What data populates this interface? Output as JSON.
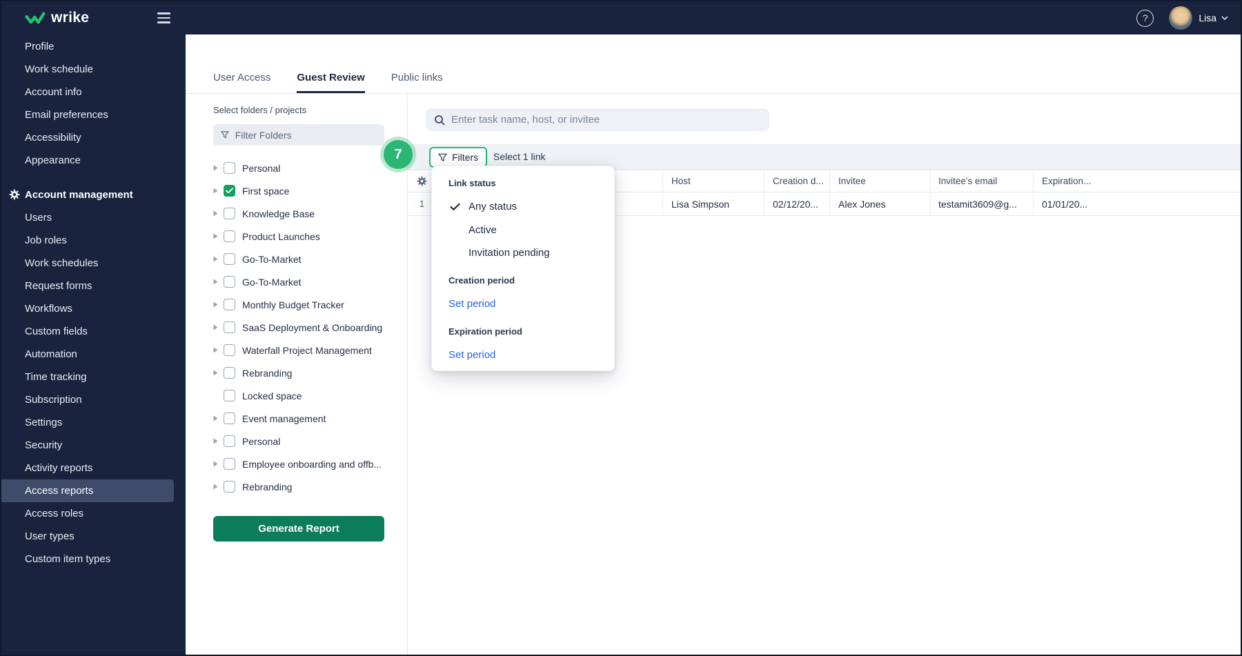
{
  "colors": {
    "navy": "#19233E",
    "brand_green": "#23C16E",
    "annotation_green": "#2BB673",
    "button_green": "#0B7D5A",
    "checkbox_green": "#12A05F",
    "link_blue": "#2563EB"
  },
  "topbar": {
    "logo_text": "wrike",
    "help_label": "?",
    "user_name": "Lisa"
  },
  "sidebar": {
    "items_top": [
      {
        "label": "Profile"
      },
      {
        "label": "Work schedule"
      },
      {
        "label": "Account info"
      },
      {
        "label": "Email preferences"
      },
      {
        "label": "Accessibility"
      },
      {
        "label": "Appearance"
      }
    ],
    "section_header": "Account management",
    "items": [
      {
        "label": "Users"
      },
      {
        "label": "Job roles"
      },
      {
        "label": "Work schedules"
      },
      {
        "label": "Request forms"
      },
      {
        "label": "Workflows"
      },
      {
        "label": "Custom fields"
      },
      {
        "label": "Automation"
      },
      {
        "label": "Time tracking"
      },
      {
        "label": "Subscription"
      },
      {
        "label": "Settings"
      },
      {
        "label": "Security"
      },
      {
        "label": "Activity reports"
      },
      {
        "label": "Access reports"
      },
      {
        "label": "Access roles"
      },
      {
        "label": "User types"
      },
      {
        "label": "Custom item types"
      }
    ],
    "selected_item": "Access reports"
  },
  "tabs": [
    {
      "label": "User Access",
      "active": false
    },
    {
      "label": "Guest Review",
      "active": true
    },
    {
      "label": "Public links",
      "active": false
    }
  ],
  "folder_panel": {
    "title": "Select folders / projects",
    "filter_placeholder": "Filter Folders",
    "tree": [
      {
        "label": "Personal",
        "checked": false,
        "expandable": true
      },
      {
        "label": "First space",
        "checked": true,
        "expandable": true
      },
      {
        "label": "Knowledge Base",
        "checked": false,
        "expandable": true
      },
      {
        "label": "Product Launches",
        "checked": false,
        "expandable": true
      },
      {
        "label": "Go-To-Market",
        "checked": false,
        "expandable": true
      },
      {
        "label": "Go-To-Market",
        "checked": false,
        "expandable": true
      },
      {
        "label": "Monthly Budget Tracker",
        "checked": false,
        "expandable": true
      },
      {
        "label": "SaaS Deployment & Onboarding",
        "checked": false,
        "expandable": true
      },
      {
        "label": "Waterfall Project Management",
        "checked": false,
        "expandable": true
      },
      {
        "label": "Rebranding",
        "checked": false,
        "expandable": true
      },
      {
        "label": "Locked space",
        "checked": false,
        "expandable": false
      },
      {
        "label": "Event management",
        "checked": false,
        "expandable": true
      },
      {
        "label": "Personal",
        "checked": false,
        "expandable": true
      },
      {
        "label": "Employee onboarding and offb...",
        "checked": false,
        "expandable": true
      },
      {
        "label": "Rebranding",
        "checked": false,
        "expandable": true
      }
    ],
    "generate_button": "Generate Report"
  },
  "report": {
    "search_placeholder": "Enter task name, host, or invitee",
    "filters_button": "Filters",
    "selection_info": "Select 1 link",
    "table": {
      "headers": [
        "",
        "",
        "Host",
        "Creation d...",
        "Invitee",
        "Invitee's email",
        "Expiration..."
      ],
      "rows": [
        {
          "num": "1",
          "task": "",
          "host": "Lisa Simpson",
          "creation": "02/12/20...",
          "invitee": "Alex Jones",
          "invitee_email": "testamit3609@g...",
          "expiration": "01/01/20..."
        }
      ]
    }
  },
  "filters_menu": {
    "link_status_title": "Link status",
    "options": [
      {
        "label": "Any status",
        "selected": true
      },
      {
        "label": "Active",
        "selected": false
      },
      {
        "label": "Invitation pending",
        "selected": false
      }
    ],
    "creation_period_title": "Creation period",
    "creation_set_period": "Set period",
    "expiration_period_title": "Expiration period",
    "expiration_set_period": "Set period"
  },
  "annotation": {
    "step_number": "7",
    "color": "#2BB673"
  }
}
